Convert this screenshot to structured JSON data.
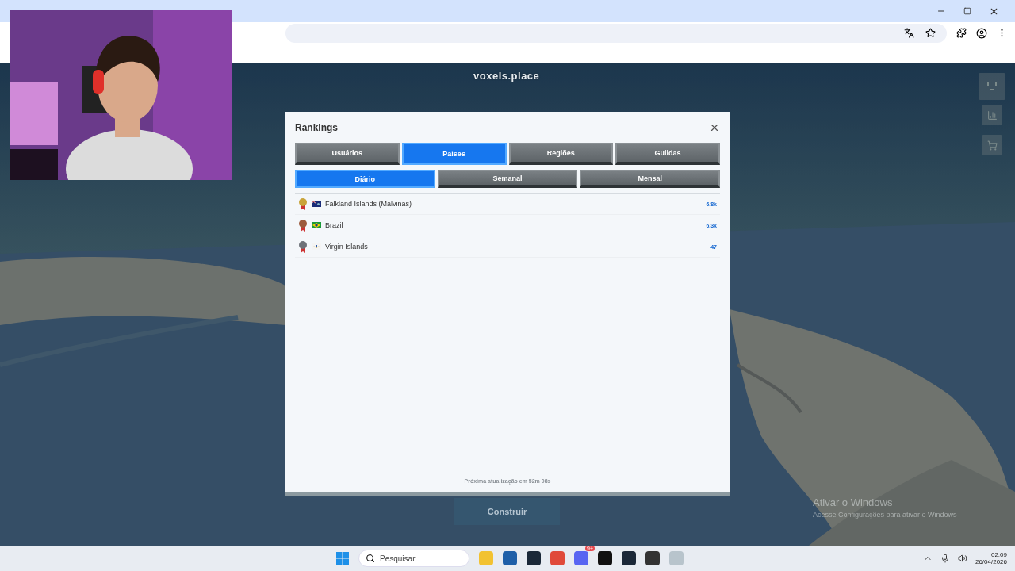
{
  "game": {
    "logo": "voxels.place",
    "build_button": "Construir"
  },
  "rankings": {
    "title": "Rankings",
    "tabs": [
      {
        "label": "Usuários",
        "selected": false
      },
      {
        "label": "Países",
        "selected": true
      },
      {
        "label": "Regiões",
        "selected": false
      },
      {
        "label": "Guildas",
        "selected": false
      }
    ],
    "periods": [
      {
        "label": "Diário",
        "selected": true
      },
      {
        "label": "Semanal",
        "selected": false
      },
      {
        "label": "Mensal",
        "selected": false
      }
    ],
    "rows": [
      {
        "kind": "falkland",
        "color": "#c9a43a",
        "name": "Falkland Islands (Malvinas)",
        "score": "6.8k"
      },
      {
        "kind": "brazil",
        "color": "#9c5a3c",
        "name": "Brazil",
        "score": "6.3k"
      },
      {
        "kind": "virgin",
        "color": "#6e7278",
        "name": "Virgin Islands",
        "score": "47"
      }
    ],
    "footer": "Próxima atualização em 52m 08s"
  },
  "activation": {
    "title": "Ativar o Windows",
    "text": "Acesse Configurações para ativar o Windows"
  },
  "taskbar": {
    "search_placeholder": "Pesquisar",
    "chat_badge": "9+",
    "time": "02:09",
    "date": "26/04/2026"
  }
}
